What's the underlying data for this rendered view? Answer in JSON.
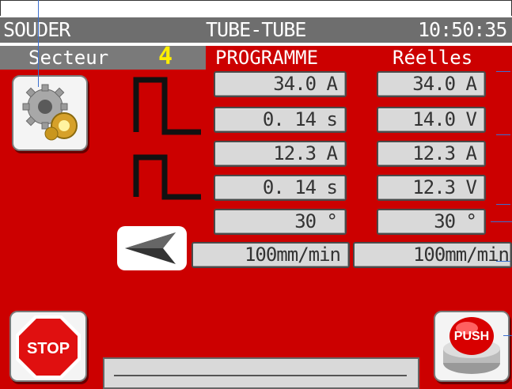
{
  "header": {
    "app": "SOUDER",
    "mode": "TUBE-TUBE",
    "time": "10:50:35"
  },
  "subheader": {
    "sector_label": "Secteur",
    "sector_value": "4",
    "col_program": "PROGRAMME",
    "col_real": "Réelles"
  },
  "program": [
    "34.0 A",
    "0. 14 s",
    "12.3 A",
    "0. 14 s",
    "30 °",
    "100mm/min"
  ],
  "real": [
    "34.0 A",
    "14.0 V",
    "12.3 A",
    "12.3 V",
    "30 °",
    "100mm/min"
  ],
  "buttons": {
    "stop": "STOP",
    "push": "PUSH"
  },
  "colors": {
    "background": "#cc0000",
    "bar": "#6e6e6e",
    "sector": "#ffee00",
    "box": "#d9d9d9"
  }
}
